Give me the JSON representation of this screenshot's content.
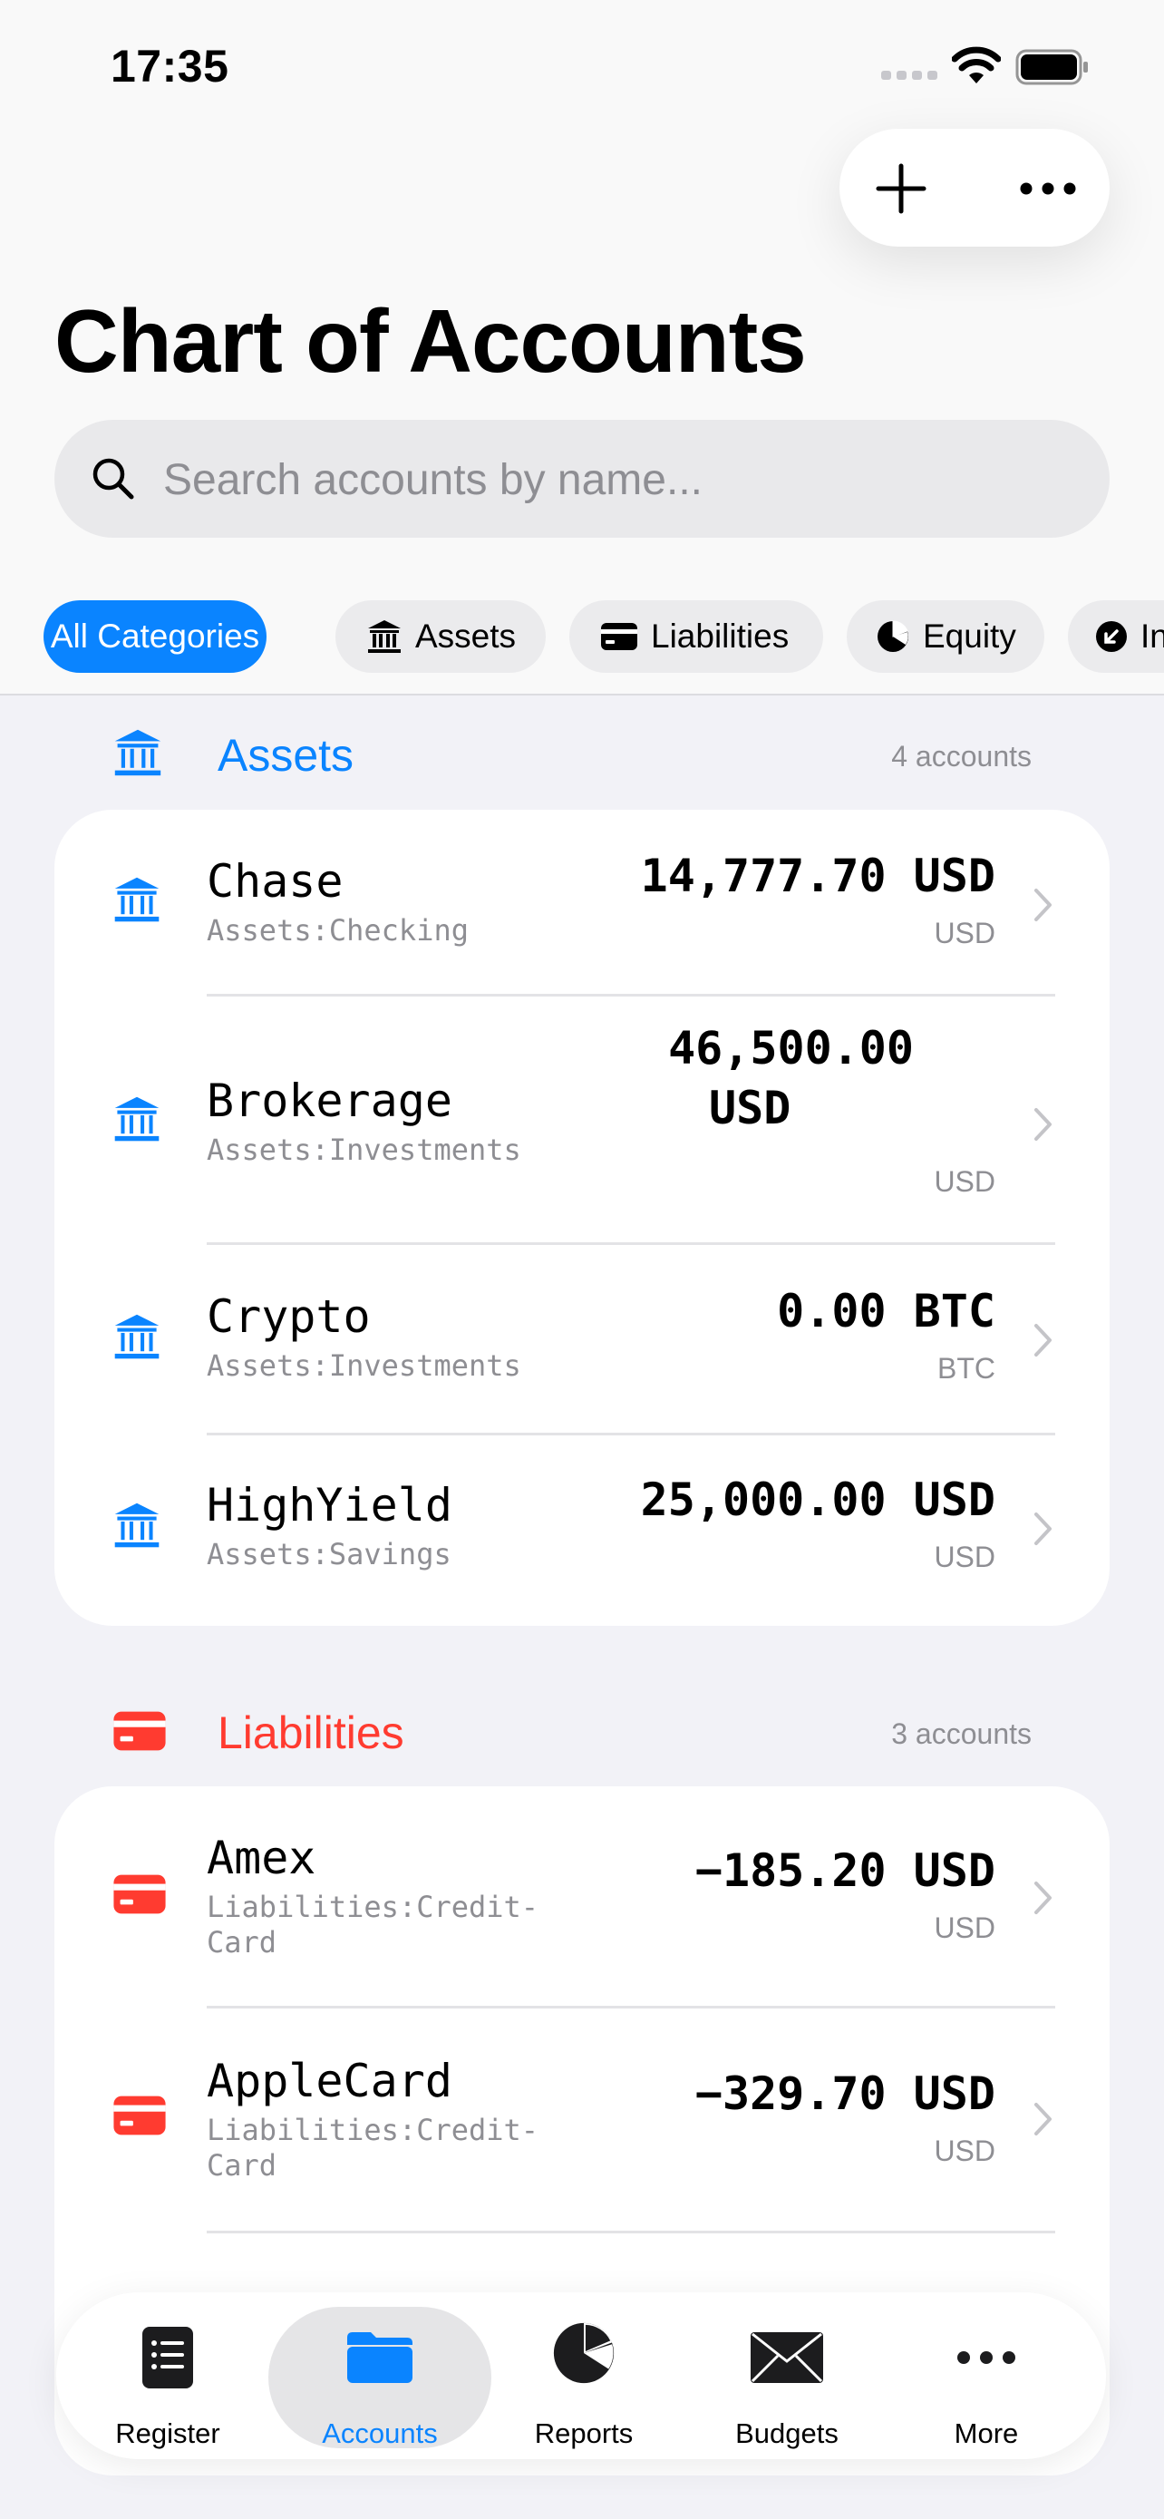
{
  "status_bar": {
    "time": "17:35"
  },
  "toolbar": {
    "add_icon": "plus-icon",
    "more_icon": "ellipsis-icon"
  },
  "page": {
    "title": "Chart of Accounts"
  },
  "search": {
    "placeholder": "Search accounts by name..."
  },
  "categories": [
    {
      "label": "All Categories",
      "active": true
    },
    {
      "label": "Assets",
      "icon": "bank-icon"
    },
    {
      "label": "Liabilities",
      "icon": "credit-card-icon"
    },
    {
      "label": "Equity",
      "icon": "pie-chart-icon"
    },
    {
      "label": "In",
      "icon": "arrow-down-left-circle-icon"
    }
  ],
  "sections": [
    {
      "title": "Assets",
      "count": "4 accounts",
      "color": "#0a84ff",
      "accounts": [
        {
          "name": "Chase",
          "path": "Assets:Checking",
          "amount": "14,777.70 USD",
          "currency": "USD"
        },
        {
          "name": "Brokerage",
          "path": "Assets:Investments",
          "amount_line1": "46,500.00",
          "amount_line2": "USD",
          "currency": "USD"
        },
        {
          "name": "Crypto",
          "path": "Assets:Investments",
          "amount": "0.00 BTC",
          "currency": "BTC"
        },
        {
          "name": "HighYield",
          "path": "Assets:Savings",
          "amount": "25,000.00 USD",
          "currency": "USD"
        }
      ]
    },
    {
      "title": "Liabilities",
      "count": "3 accounts",
      "color": "#ff3b30",
      "accounts": [
        {
          "name": "Amex",
          "path_line1": "Liabilities:Credit-",
          "path_line2": "Card",
          "amount": "−185.20 USD",
          "currency": "USD"
        },
        {
          "name": "AppleCard",
          "path_line1": "Liabilities:Credit-",
          "path_line2": "Card",
          "amount": "−329.70 USD",
          "currency": "USD"
        }
      ]
    }
  ],
  "tabs": [
    {
      "label": "Register",
      "icon": "list-icon"
    },
    {
      "label": "Accounts",
      "icon": "folder-icon",
      "active": true
    },
    {
      "label": "Reports",
      "icon": "pie-chart-icon"
    },
    {
      "label": "Budgets",
      "icon": "envelope-icon"
    },
    {
      "label": "More",
      "icon": "ellipsis-icon"
    }
  ]
}
